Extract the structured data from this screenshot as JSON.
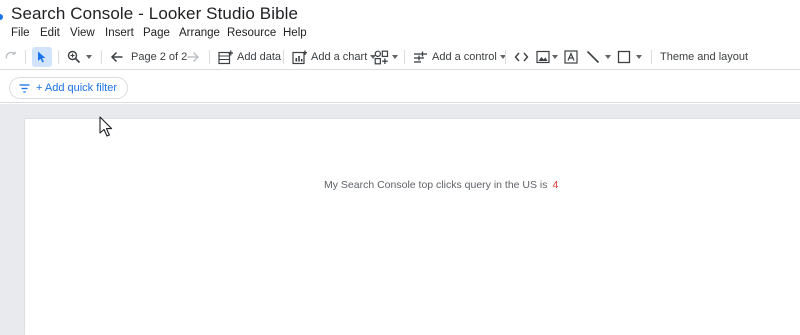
{
  "document": {
    "title": "Search Console - Looker Studio Bible"
  },
  "menu": {
    "items": [
      "File",
      "Edit",
      "View",
      "Insert",
      "Page",
      "Arrange",
      "Resource",
      "Help"
    ]
  },
  "toolbar": {
    "page_indicator": "Page 2 of 2",
    "add_data": "Add data",
    "add_chart": "Add a chart",
    "add_control": "Add a control",
    "theme_layout": "Theme and layout"
  },
  "filter_bar": {
    "quick_filter_label": "+ Add quick filter"
  },
  "report": {
    "scorecard_label": "My Search Console top clicks query in the US is",
    "scorecard_value": "4"
  },
  "colors": {
    "accent": "#1a73e8",
    "selected_tool_bg": "#d2e3fc",
    "value_red": "#e53935",
    "workspace_bg": "#e8eaed"
  },
  "icons": {
    "toolbar": [
      "redo-icon",
      "select-pointer-icon",
      "zoom-icon",
      "back-arrow-icon",
      "forward-arrow-icon",
      "add-data-icon",
      "add-chart-icon",
      "community-viz-icon",
      "add-control-icon",
      "embed-code-icon",
      "image-icon",
      "text-box-icon",
      "line-icon",
      "shape-rectangle-icon"
    ],
    "filter": "filter-icon",
    "cursor": "mouse-pointer"
  }
}
